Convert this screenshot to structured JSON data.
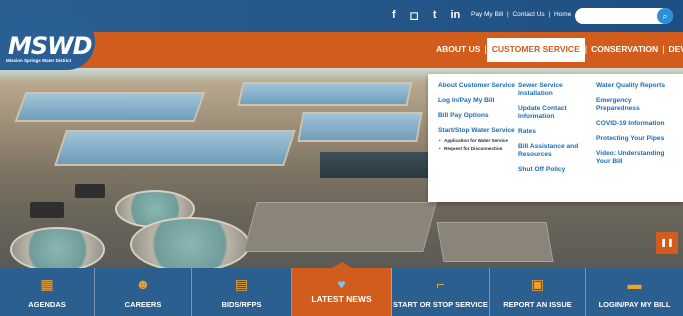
{
  "logo": {
    "text": "MSWD",
    "subtitle": "Mission Springs Water District"
  },
  "social": [
    "f",
    "◻",
    "t",
    "in"
  ],
  "top_links": [
    "Pay My Bill",
    "|",
    "Contact Us",
    "|",
    "Home"
  ],
  "search": {
    "placeholder": "",
    "button_icon": "search-icon"
  },
  "nav": {
    "items": [
      {
        "label": "ABOUT US"
      },
      {
        "label": "CUSTOMER SERVICE"
      },
      {
        "label": "CONSERVATION"
      },
      {
        "label": "DEVELOPMENT"
      }
    ],
    "separator": "|"
  },
  "dropdown": {
    "col1": {
      "links": [
        "About Customer Service",
        "Log In/Pay My Bill",
        "Bill Pay Options",
        "Start/Stop Water Service"
      ],
      "sub": [
        "Application for Water Service",
        "Request for Disconnection"
      ]
    },
    "col2": {
      "links": [
        "Sewer Service Installation",
        "Update Contact Information",
        "Rates",
        "Bill Assistance and Resources",
        "Shut Off Policy"
      ]
    },
    "col3": {
      "links": [
        "Water Quality Reports",
        "Emergency Preparedness",
        "COVID-19 Information",
        "Protecting Your Pipes",
        "Video: Understanding Your Bill"
      ]
    }
  },
  "bottom": {
    "tiles": [
      {
        "label": "AGENDAS",
        "icon": "calendar-icon"
      },
      {
        "label": "CAREERS",
        "icon": "people-icon"
      },
      {
        "label": "BIDS/RFPS",
        "icon": "document-icon"
      },
      {
        "label": "LATEST NEWS",
        "icon": "news-icon"
      },
      {
        "label": "START OR STOP SERVICE",
        "icon": "faucet-icon"
      },
      {
        "label": "REPORT AN ISSUE",
        "icon": "report-icon"
      },
      {
        "label": "LOGIN/PAY MY BILL",
        "icon": "card-icon"
      }
    ]
  },
  "colors": {
    "brand_blue": "#2b5f90",
    "brand_orange": "#d25c1c",
    "link_blue": "#1b6cb6"
  }
}
